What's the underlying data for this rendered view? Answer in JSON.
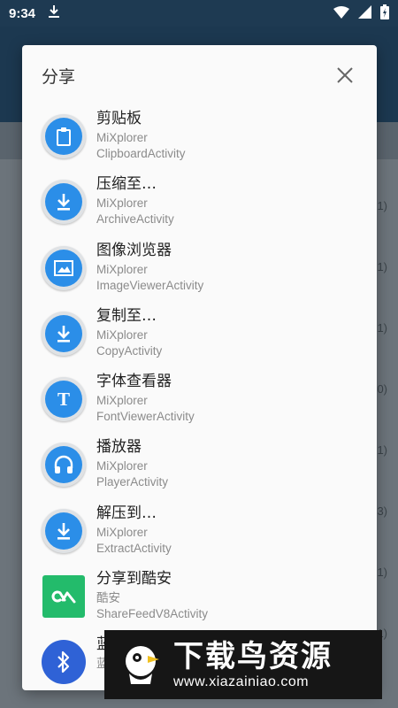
{
  "status_bar": {
    "time": "9:34"
  },
  "background_counts": [
    "1)",
    "1)",
    "1)",
    "0)",
    "1)",
    "3)",
    "1)",
    "1)"
  ],
  "dialog": {
    "title": "分享",
    "items": [
      {
        "label": "剪贴板",
        "package": "MiXplorer",
        "activity": "ClipboardActivity",
        "icon": "clipboard-icon"
      },
      {
        "label": "压缩至…",
        "package": "MiXplorer",
        "activity": "ArchiveActivity",
        "icon": "download-icon"
      },
      {
        "label": "图像浏览器",
        "package": "MiXplorer",
        "activity": "ImageViewerActivity",
        "icon": "image-icon"
      },
      {
        "label": "复制至…",
        "package": "MiXplorer",
        "activity": "CopyActivity",
        "icon": "download-icon"
      },
      {
        "label": "字体查看器",
        "package": "MiXplorer",
        "activity": "FontViewerActivity",
        "icon": "font-icon"
      },
      {
        "label": "播放器",
        "package": "MiXplorer",
        "activity": "PlayerActivity",
        "icon": "headphones-icon"
      },
      {
        "label": "解压到…",
        "package": "MiXplorer",
        "activity": "ExtractActivity",
        "icon": "download-icon"
      },
      {
        "label": "分享到酷安",
        "package": "酷安",
        "activity": "ShareFeedV8Activity",
        "icon": "coolapk-icon"
      },
      {
        "label": "蓝",
        "package": "蓝",
        "activity": "",
        "icon": "bluetooth-icon"
      }
    ]
  },
  "watermark": {
    "title": "下载鸟资源",
    "url": "www.xiazainiao.com"
  },
  "colors": {
    "accent": "#2b8ee8",
    "coolapk": "#23bb6b",
    "bluetooth": "#2f62d6",
    "status_bar": "#1e3a52"
  }
}
